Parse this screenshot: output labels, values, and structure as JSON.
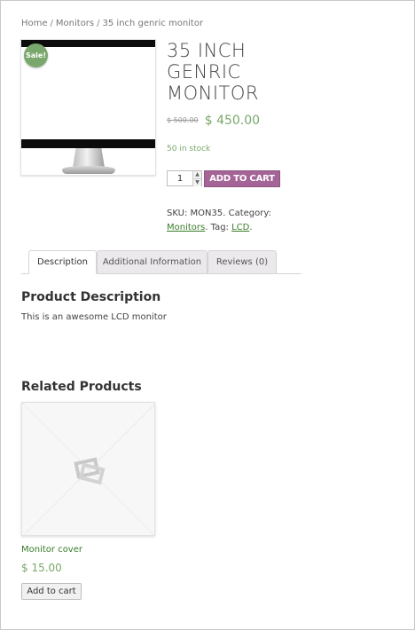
{
  "breadcrumb": {
    "home": "Home",
    "category": "Monitors",
    "current": "35 inch genric monitor",
    "separator": "/"
  },
  "product": {
    "sale_badge": "Sale!",
    "title": "35 INCH GENRIC MONITOR",
    "price_old": "$ 500.00",
    "price_new": "$ 450.00",
    "stock": "50 in stock",
    "quantity": "1",
    "add_to_cart_label": "ADD TO CART",
    "sku_label": "SKU:",
    "sku_value": "MON35",
    "category_label": "Category:",
    "category_link": "Monitors",
    "tag_label": "Tag:",
    "tag_link": "LCD"
  },
  "tabs": [
    {
      "label": "Description",
      "active": true
    },
    {
      "label": "Additional Information",
      "active": false
    },
    {
      "label": "Reviews (0)",
      "active": false
    }
  ],
  "description": {
    "heading": "Product Description",
    "text": "This is an awesome LCD monitor"
  },
  "related": {
    "heading": "Related Products",
    "items": [
      {
        "name": "Monitor cover",
        "price": "$ 15.00",
        "button_label": "Add to cart"
      }
    ]
  },
  "colors": {
    "accent_purple": "#a46497",
    "price_green": "#7aa76c",
    "link_green": "#3a7c2a",
    "sale_badge": "#7aa76c"
  },
  "icons": {
    "placeholder": "image-placeholder-icon",
    "spinner_up": "caret-up-icon",
    "spinner_down": "caret-down-icon"
  }
}
